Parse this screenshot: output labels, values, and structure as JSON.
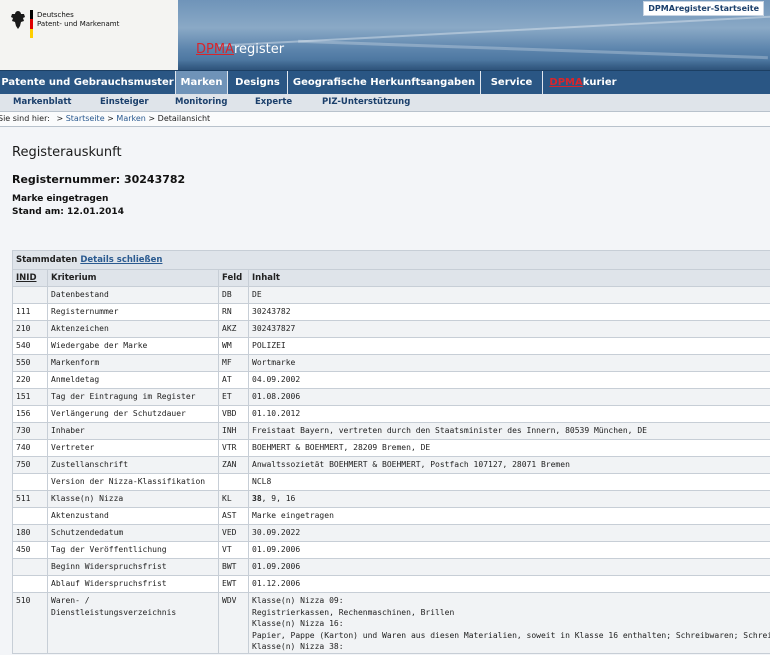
{
  "header": {
    "logo_line1": "Deutsches",
    "logo_line2": "Patent- und Markenamt",
    "brand_prefix": "DPMA",
    "brand_suffix": "register",
    "start_link": "DPMAregister-Startseite",
    "colors": {
      "nav": "#2a5684",
      "active": "#6f93b8",
      "accent_red": "#d8252b"
    }
  },
  "mainnav": {
    "patente": "Patente und Gebrauchsmuster",
    "marken": "Marken",
    "designs": "Designs",
    "geo": "Geografische Herkunftsangaben",
    "service": "Service",
    "kurier_prefix": "DPMA",
    "kurier_suffix": "kurier"
  },
  "subnav": {
    "markenblatt": "Markenblatt",
    "einsteiger": "Einsteiger",
    "monitoring": "Monitoring",
    "experte": "Experte",
    "piz": "PIZ-Unterstützung"
  },
  "breadcrumb": {
    "prefix": "Sie sind hier:",
    "sep": ">",
    "startseite": "Startseite",
    "marken": "Marken",
    "current": "Detailansicht"
  },
  "page": {
    "title": "Registerauskunft",
    "regnr": "Registernummer: 30243782",
    "status": "Marke eingetragen",
    "stand": "Stand am: 12.01.2014"
  },
  "table": {
    "caption": "Stammdaten",
    "details_link": "Details schließen",
    "headers": {
      "inid": "INID",
      "kriterium": "Kriterium",
      "feld": "Feld",
      "inhalt": "Inhalt"
    },
    "rows": [
      {
        "inid": "",
        "kriterium": "Datenbestand",
        "feld": "DB",
        "inhalt": "DE"
      },
      {
        "inid": "111",
        "kriterium": "Registernummer",
        "feld": "RN",
        "inhalt": "30243782"
      },
      {
        "inid": "210",
        "kriterium": "Aktenzeichen",
        "feld": "AKZ",
        "inhalt": "302437827"
      },
      {
        "inid": "540",
        "kriterium": "Wiedergabe der Marke",
        "feld": "WM",
        "inhalt": "POLIZEI"
      },
      {
        "inid": "550",
        "kriterium": "Markenform",
        "feld": "MF",
        "inhalt": "Wortmarke"
      },
      {
        "inid": "220",
        "kriterium": "Anmeldetag",
        "feld": "AT",
        "inhalt": "04.09.2002"
      },
      {
        "inid": "151",
        "kriterium": "Tag der Eintragung im Register",
        "feld": "ET",
        "inhalt": "01.08.2006"
      },
      {
        "inid": "156",
        "kriterium": "Verlängerung der Schutzdauer",
        "feld": "VBD",
        "inhalt": "01.10.2012"
      },
      {
        "inid": "730",
        "kriterium": "Inhaber",
        "feld": "INH",
        "inhalt": "Freistaat Bayern, vertreten durch den Staatsminister des Innern, 80539 München, DE"
      },
      {
        "inid": "740",
        "kriterium": "Vertreter",
        "feld": "VTR",
        "inhalt": "BOEHMERT & BOEHMERT, 28209 Bremen, DE"
      },
      {
        "inid": "750",
        "kriterium": "Zustellanschrift",
        "feld": "ZAN",
        "inhalt": "Anwaltssozietät BOEHMERT & BOEHMERT, Postfach 107127, 28071 Bremen"
      },
      {
        "inid": "",
        "kriterium": "Version der Nizza-Klassifikation",
        "feld": "",
        "inhalt": "NCL8"
      },
      {
        "inid": "511",
        "kriterium": "Klasse(n) Nizza",
        "feld": "KL",
        "inhalt_bold": "38",
        "inhalt": ", 9, 16"
      },
      {
        "inid": "",
        "kriterium": "Aktenzustand",
        "feld": "AST",
        "inhalt": "Marke eingetragen"
      },
      {
        "inid": "180",
        "kriterium": "Schutzendedatum",
        "feld": "VED",
        "inhalt": "30.09.2022"
      },
      {
        "inid": "450",
        "kriterium": "Tag der Veröffentlichung",
        "feld": "VT",
        "inhalt": "01.09.2006"
      },
      {
        "inid": "",
        "kriterium": "Beginn Widerspruchsfrist",
        "feld": "BWT",
        "inhalt": "01.09.2006"
      },
      {
        "inid": "",
        "kriterium": "Ablauf Widerspruchsfrist",
        "feld": "EWT",
        "inhalt": "01.12.2006"
      }
    ],
    "wdv": {
      "inid": "510",
      "kriterium": "Waren- / Dienstleistungsverzeichnis",
      "feld": "WDV",
      "lines": [
        "Klasse(n) Nizza 09:",
        "Registrierkassen, Rechenmaschinen, Brillen",
        "Klasse(n) Nizza 16:",
        "Papier, Pappe (Karton) und Waren aus diesen Materialien, soweit in Klasse 16 enthalten; Schreibwaren; Schreibmas",
        "Klasse(n) Nizza 38:"
      ]
    }
  }
}
